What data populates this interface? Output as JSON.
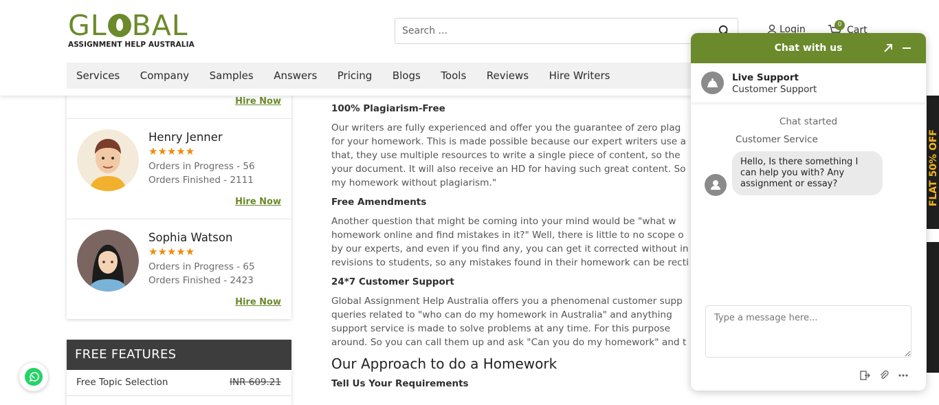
{
  "header": {
    "logo_main": "GLOBAL",
    "logo_sub": "ASSIGNMENT HELP AUSTRALIA",
    "search_placeholder": "Search ...",
    "login_label": "Login",
    "cart_label": "Cart",
    "cart_count": "0"
  },
  "nav": {
    "items": [
      "Services",
      "Company",
      "Samples",
      "Answers",
      "Pricing",
      "Blogs",
      "Tools",
      "Reviews",
      "Hire Writers"
    ]
  },
  "sidebar": {
    "hire_label": "Hire Now",
    "writers": [
      {
        "name": "Henry Jenner",
        "stars": "★★★★★",
        "orders_in_progress": "Orders in Progress - 56",
        "orders_finished": "Orders Finished - 2111"
      },
      {
        "name": "Sophia Watson",
        "stars": "★★★★★",
        "orders_in_progress": "Orders in Progress - 65",
        "orders_finished": "Orders Finished - 2423"
      }
    ],
    "features": {
      "title": "FREE FEATURES",
      "items": [
        {
          "label": "Free Topic Selection",
          "price": "INR 609.21"
        }
      ]
    }
  },
  "content": {
    "h1": "100% Plagiarism-Free",
    "p1": "Our writers are fully experienced and offer you the guarantee of zero plagiarism for your homework. This is made possible because our expert writers use a that, they use multiple resources to write a single piece of content, so the your document. It will also receive an HD for having such great content. So my homework without plagiarism.\"",
    "p1_lines": [
      "Our writers are fully experienced and offer you the guarantee of zero plag",
      "for your homework. This is made possible because our expert writers use a",
      "that, they use multiple resources to write a single piece of content, so the",
      "your document. It will also receive an HD for having such great content. So",
      "my homework without plagiarism.\""
    ],
    "h2": "Free Amendments",
    "p2_lines": [
      "Another question that might be coming into your mind would be \"what w",
      "homework online and find mistakes in it?\" Well, there is little to no scope o",
      "by our experts, and even if you find any, you can get it corrected without in",
      "revisions to students, so any mistakes found in their homework can be recti"
    ],
    "h3": "24*7 Customer Support",
    "p3_lines": [
      "Global Assignment Help Australia offers you a phenomenal customer supp",
      "queries related to \"who can do my homework in Australia\" and anything",
      "support service is made to solve problems at any time. For this purpose",
      "around. So you can call them up and ask \"Can you do my homework\" and t"
    ],
    "section_title": "Our Approach to do a Homework",
    "h4": "Tell Us Your Requirements"
  },
  "chat": {
    "title": "Chat with us",
    "agent_name": "Live Support",
    "agent_role": "Customer Support",
    "status": "Chat started",
    "sender": "Customer Service",
    "message": "Hello, Is there something I can help you with? Any assignment or essay?",
    "input_placeholder": "Type a message here..."
  },
  "colors": {
    "brand_green": "#6b8a2b",
    "star_orange": "#f08a0b",
    "dark_header": "#3d3d3d"
  }
}
